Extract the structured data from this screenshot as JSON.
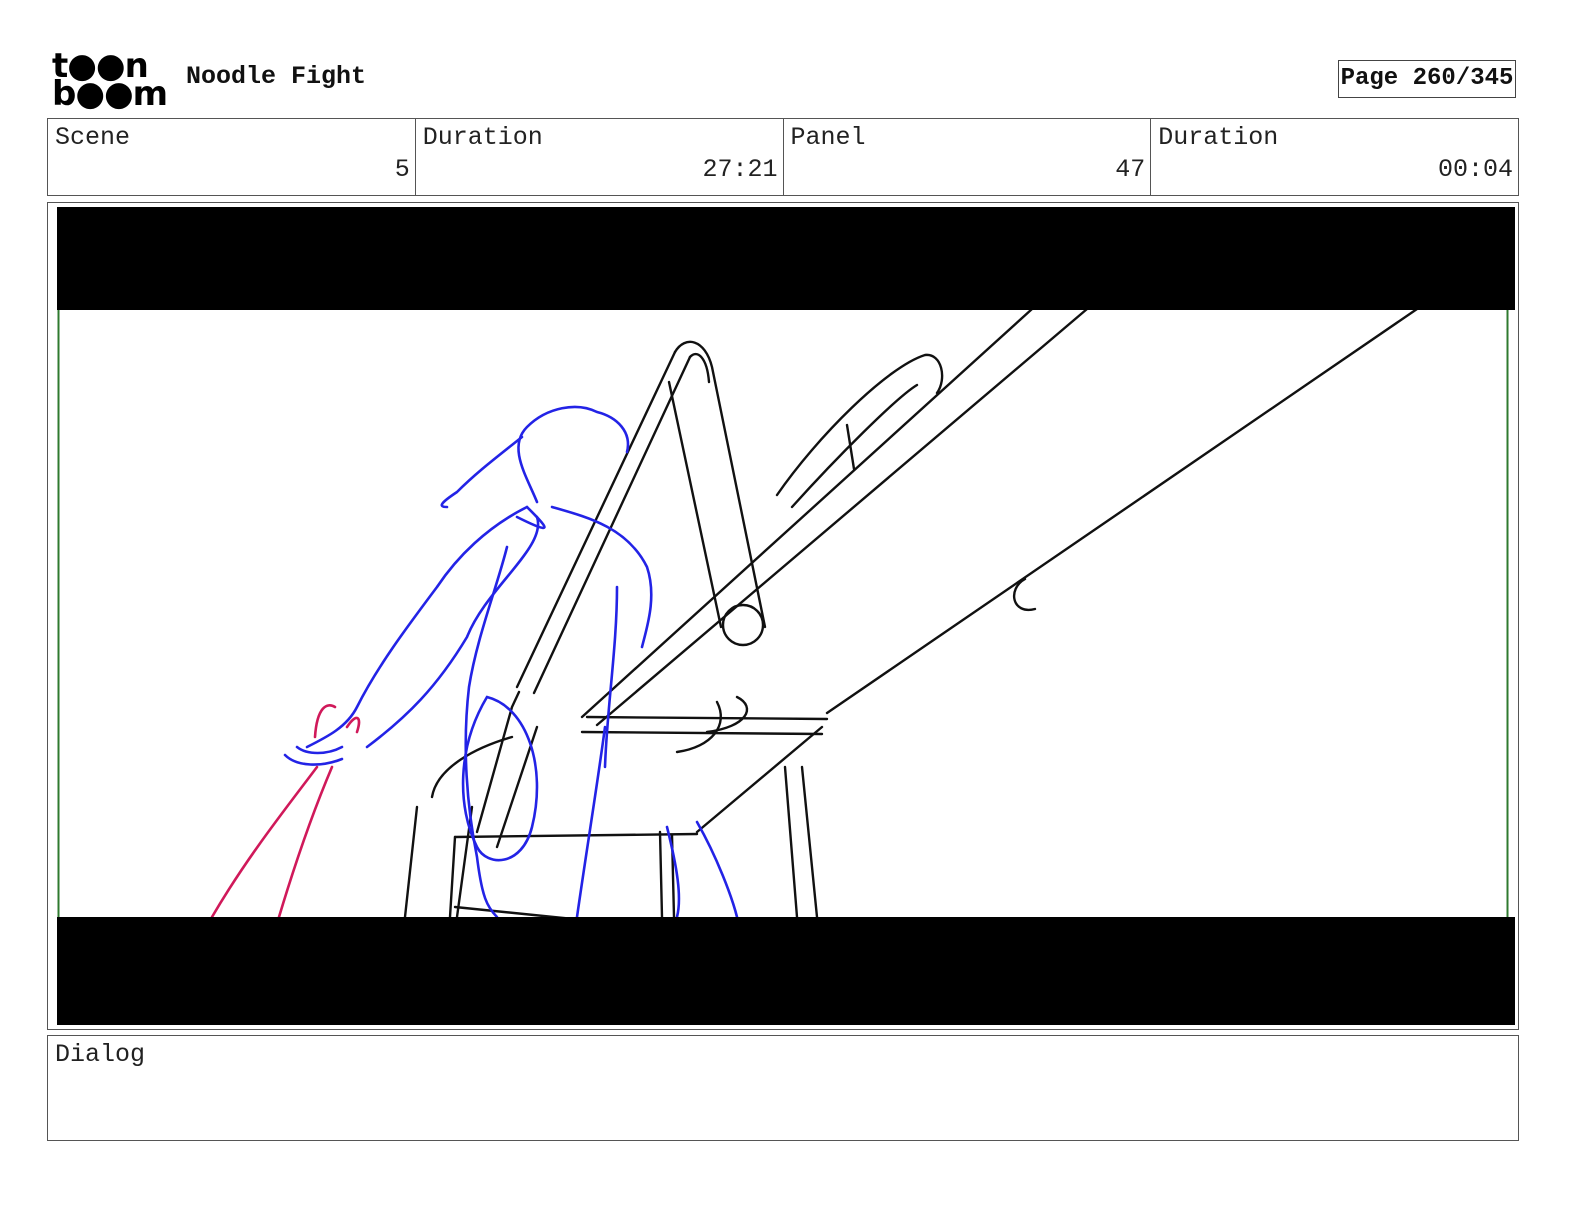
{
  "header": {
    "logo_line1": "t●●n",
    "logo_line2": "b●●m",
    "project_title": "Noodle Fight",
    "page": "Page 260/345"
  },
  "info": {
    "scene_label": "Scene",
    "scene_value": "5",
    "scene_duration_label": "Duration",
    "scene_duration_value": "27:21",
    "panel_label": "Panel",
    "panel_value": "47",
    "panel_duration_label": "Duration",
    "panel_duration_value": "00:04"
  },
  "dialog": {
    "label": "Dialog"
  },
  "colors": {
    "sketch_black": "#111111",
    "sketch_blue": "#2323e6",
    "sketch_red": "#d0195a",
    "frame_green": "#2f7a2f",
    "letterbox": "#000000"
  }
}
